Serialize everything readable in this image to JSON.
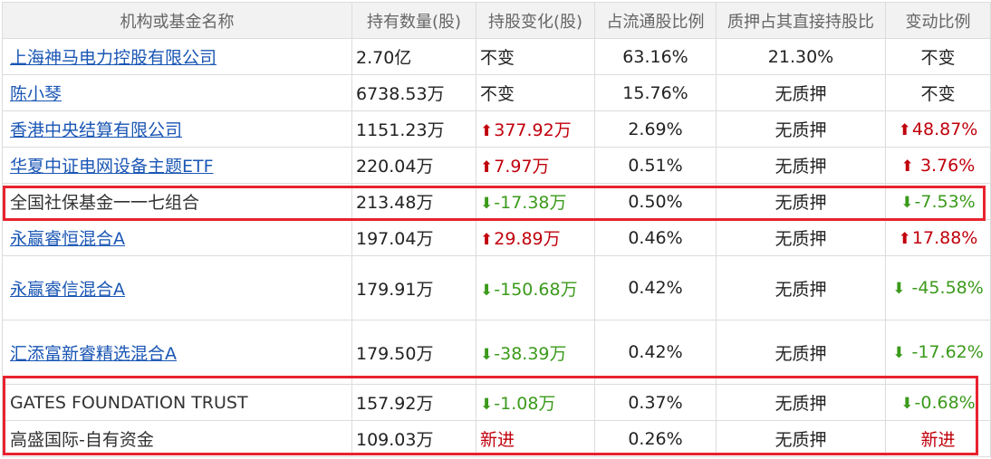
{
  "headers": [
    "机构或基金名称",
    "持有数量(股)",
    "持股变化(股)",
    "占流通股比例",
    "质押占其直接持股比",
    "变动比例"
  ],
  "arrow_icons": {
    "up": "⬆",
    "down": "⬇"
  },
  "colors": {
    "up": "#c0000b",
    "down": "#3b9a1b",
    "link": "#1a56b4",
    "highlight": "#e8232f"
  },
  "rows": [
    {
      "name": "上海神马电力控股有限公司",
      "link": true,
      "shares": "2.70亿",
      "change": "不变",
      "change_dir": "none",
      "float_ratio": "63.16%",
      "pledge": "21.30%",
      "ratio": "不变",
      "ratio_dir": "none"
    },
    {
      "name": "陈小琴",
      "link": true,
      "shares": "6738.53万",
      "change": "不变",
      "change_dir": "none",
      "float_ratio": "15.76%",
      "pledge": "无质押",
      "ratio": "不变",
      "ratio_dir": "none"
    },
    {
      "name": "香港中央结算有限公司",
      "link": true,
      "shares": "1151.23万",
      "change": "377.92万",
      "change_dir": "up",
      "float_ratio": "2.69%",
      "pledge": "无质押",
      "ratio": "48.87%",
      "ratio_dir": "up"
    },
    {
      "name": "华夏中证电网设备主题ETF",
      "link": true,
      "shares": "220.04万",
      "change": "7.97万",
      "change_dir": "up",
      "float_ratio": "0.51%",
      "pledge": "无质押",
      "ratio": " 3.76%",
      "ratio_dir": "up"
    },
    {
      "name": "全国社保基金一一七组合",
      "link": false,
      "shares": "213.48万",
      "change": "-17.38万",
      "change_dir": "down",
      "float_ratio": "0.50%",
      "pledge": "无质押",
      "ratio": "-7.53%",
      "ratio_dir": "down"
    },
    {
      "name": "永赢睿恒混合A",
      "link": true,
      "shares": "197.04万",
      "change": "29.89万",
      "change_dir": "up",
      "float_ratio": "0.46%",
      "pledge": "无质押",
      "ratio": "17.88%",
      "ratio_dir": "up"
    },
    {
      "name": "永赢睿信混合A",
      "link": true,
      "shares": "179.91万",
      "change": "-150.68万",
      "change_dir": "down",
      "float_ratio": "0.42%",
      "pledge": "无质押",
      "ratio": " -45.58%",
      "ratio_dir": "down",
      "tall": true
    },
    {
      "name": "汇添富新睿精选混合A",
      "link": true,
      "shares": "179.50万",
      "change": "-38.39万",
      "change_dir": "down",
      "float_ratio": "0.42%",
      "pledge": "无质押",
      "ratio": " -17.62%",
      "ratio_dir": "down",
      "tall": true
    },
    {
      "name": "GATES FOUNDATION TRUST",
      "link": false,
      "shares": "157.92万",
      "change": "-1.08万",
      "change_dir": "down",
      "float_ratio": "0.37%",
      "pledge": "无质押",
      "ratio": "-0.68%",
      "ratio_dir": "down"
    },
    {
      "name": "高盛国际-自有资金",
      "link": false,
      "shares": "109.03万",
      "change": "新进",
      "change_dir": "new",
      "float_ratio": "0.26%",
      "pledge": "无质押",
      "ratio": "新进",
      "ratio_dir": "new"
    }
  ]
}
